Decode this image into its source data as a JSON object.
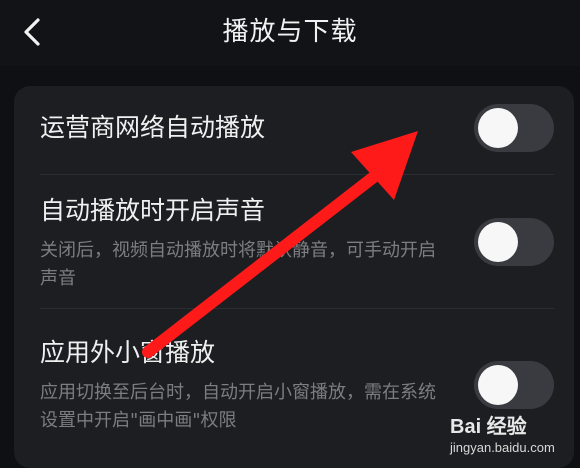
{
  "header": {
    "title": "播放与下载",
    "back_icon": "chevron-left-icon"
  },
  "settings": [
    {
      "title": "运营商网络自动播放",
      "description": "",
      "enabled": false
    },
    {
      "title": "自动播放时开启声音",
      "description": "关闭后，视频自动播放时将默认静音，可手动开启声音",
      "enabled": false
    },
    {
      "title": "应用外小窗播放",
      "description": "应用切换至后台时，自动开启小窗播放，需在系统设置中开启\"画中画\"权限",
      "enabled": false
    }
  ],
  "annotation": {
    "type": "red-arrow",
    "color": "#ff1a1a"
  },
  "watermark": {
    "brand_text": "Bai 经验",
    "url_text": "jingyan.baidu.com"
  },
  "colors": {
    "background": "#0f1013",
    "card": "#1d1e22",
    "toggle_off_track": "#3a3b40",
    "toggle_knob": "#f7f7f7",
    "secondary_text": "#7c7d82"
  }
}
